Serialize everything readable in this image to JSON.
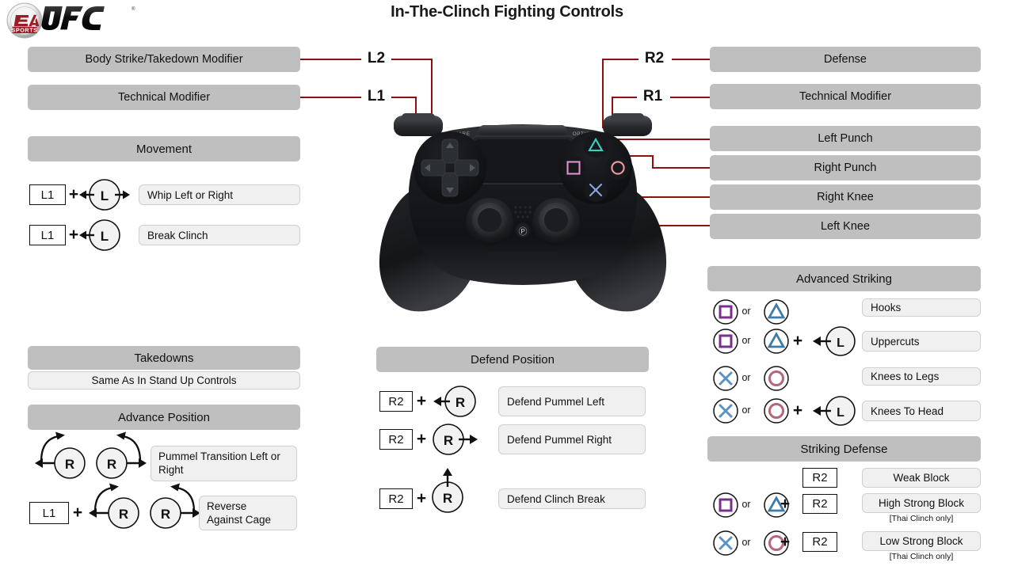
{
  "page": {
    "title": "In-The-Clinch Fighting Controls",
    "brand_ea": "EA",
    "brand_sports": "SPORTS",
    "brand_ufc": "UFC"
  },
  "colors": {
    "connector_red": "#8c1010",
    "header_gray": "#bfbfbf",
    "result_gray": "#f0f0f0",
    "ps_square_purple": "#7a2f8f",
    "ps_triangle_blue": "#3f7ba8",
    "ps_cross_blue": "#5b92c4",
    "ps_circle_pink": "#b8657c"
  },
  "pad_labels": {
    "l2": "L2",
    "l1": "L1",
    "r2": "R2",
    "r1": "R1"
  },
  "left_top_labels": [
    {
      "text": "Body Strike/Takedown Modifier"
    },
    {
      "text": "Technical Modifier"
    }
  ],
  "right_top_labels": [
    {
      "text": "Defense"
    },
    {
      "text": "Technical Modifier"
    },
    {
      "text": "Left Punch"
    },
    {
      "text": "Right Punch"
    },
    {
      "text": "Right Knee"
    },
    {
      "text": "Left Knee"
    }
  ],
  "movement": {
    "header": "Movement",
    "rows": [
      {
        "key": "L1",
        "plus": "+",
        "stick": "L",
        "arrows": "left-right",
        "result": "Whip Left or Right"
      },
      {
        "key": "L1",
        "plus": "+",
        "stick": "L",
        "arrows": "left",
        "result": "Break Clinch"
      }
    ]
  },
  "takedowns": {
    "header": "Takedowns",
    "result": "Same As In Stand Up Controls"
  },
  "advance_position": {
    "header": "Advance Position",
    "rows": [
      {
        "key": null,
        "plus": null,
        "stick_left": "R",
        "stick_right": "R",
        "result": "Pummel  Transition Left or  Right"
      },
      {
        "key": "L1",
        "plus": "+",
        "stick_left": "R",
        "stick_right": "R",
        "result": "Reverse\nAgainst Cage"
      }
    ]
  },
  "defend_position": {
    "header": "Defend Position",
    "rows": [
      {
        "key": "R2",
        "plus": "+",
        "stick": "R",
        "arrow": "left",
        "result": "Defend Pummel  Left"
      },
      {
        "key": "R2",
        "plus": "+",
        "stick": "R",
        "arrow": "right",
        "result": "Defend Pummel  Right"
      },
      {
        "key": "R2",
        "plus": "+",
        "stick": "R",
        "arrow": "up",
        "result": "Defend Clinch Break"
      }
    ]
  },
  "advanced_striking": {
    "header": "Advanced Striking",
    "or_label": "or",
    "rows": [
      {
        "btn_a": "square",
        "btn_b": "triangle",
        "plus": null,
        "stick": null,
        "result": "Hooks"
      },
      {
        "btn_a": "square",
        "btn_b": "triangle",
        "plus": "+",
        "stick": "L",
        "result": "Uppercuts"
      },
      {
        "btn_a": "cross",
        "btn_b": "circle",
        "plus": null,
        "stick": null,
        "result": "Knees to Legs"
      },
      {
        "btn_a": "cross",
        "btn_b": "circle",
        "plus": "+",
        "stick": "L",
        "result": "Knees To Head"
      }
    ]
  },
  "striking_defense": {
    "header": "Striking Defense",
    "or_label": "or",
    "rows": [
      {
        "btn_a": null,
        "btn_b": null,
        "plus": null,
        "key": "R2",
        "result": "Weak Block",
        "note": null
      },
      {
        "btn_a": "square",
        "btn_b": "triangle",
        "plus": "+",
        "key": "R2",
        "result": "High Strong  Block",
        "note": "[Thai Clinch only]"
      },
      {
        "btn_a": "cross",
        "btn_b": "circle",
        "plus": "+",
        "key": "R2",
        "result": "Low Strong  Block",
        "note": "[Thai Clinch only]"
      }
    ]
  },
  "controller": {
    "name": "dualshock-4-controller",
    "share_label": "SHARE",
    "options_label": "OPTIONS"
  }
}
